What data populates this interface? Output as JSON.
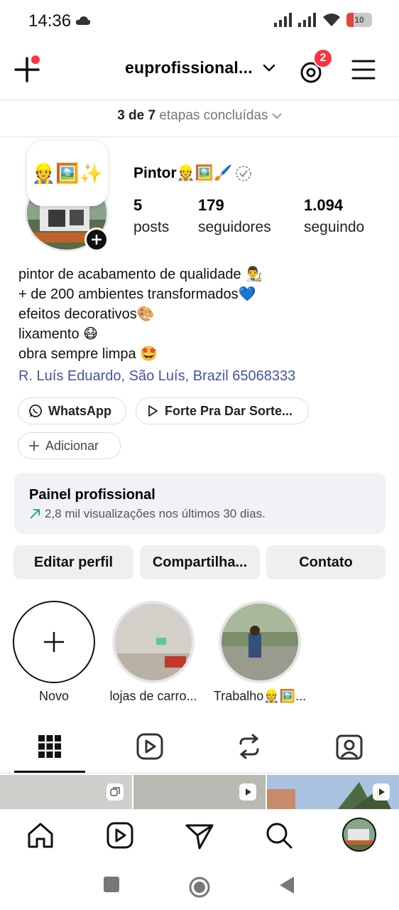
{
  "status_bar": {
    "time": "14:36",
    "battery": "10"
  },
  "header": {
    "username": "euprofissional...",
    "threads_badge": "2"
  },
  "steps": {
    "done": "3 de 7",
    "rest": "etapas concluídas"
  },
  "profile": {
    "note": "👷🖼️✨",
    "display_name": "Pintor👷🖼️🖌️",
    "stats": [
      {
        "value": "5",
        "label": "posts"
      },
      {
        "value": "179",
        "label": "seguidores"
      },
      {
        "value": "1.094",
        "label": "seguindo"
      }
    ],
    "bio": [
      "pintor de acabamento de qualidade 👨‍🎨",
      "+ de 200 ambientes transformados💙",
      "efeitos decorativos🎨",
      "lixamento 😷",
      "obra sempre limpa 🤩"
    ],
    "address": "R. Luís Eduardo, São Luís, Brazil 65068333"
  },
  "links": {
    "whatsapp": "WhatsApp",
    "music": "Forte Pra Dar Sorte...",
    "add": "Adicionar"
  },
  "dashboard": {
    "title": "Painel profissional",
    "subtitle": "2,8 mil visualizações nos últimos 30 dias."
  },
  "buttons": {
    "edit": "Editar perfil",
    "share": "Compartilha...",
    "contact": "Contato"
  },
  "highlights": [
    {
      "label": "Novo"
    },
    {
      "label": "lojas de carro..."
    },
    {
      "label": "Trabalho👷🖼️..."
    }
  ],
  "colors": {
    "accent": "#ff3040",
    "link": "#3f55a8",
    "panel": "#f0f2f5"
  }
}
